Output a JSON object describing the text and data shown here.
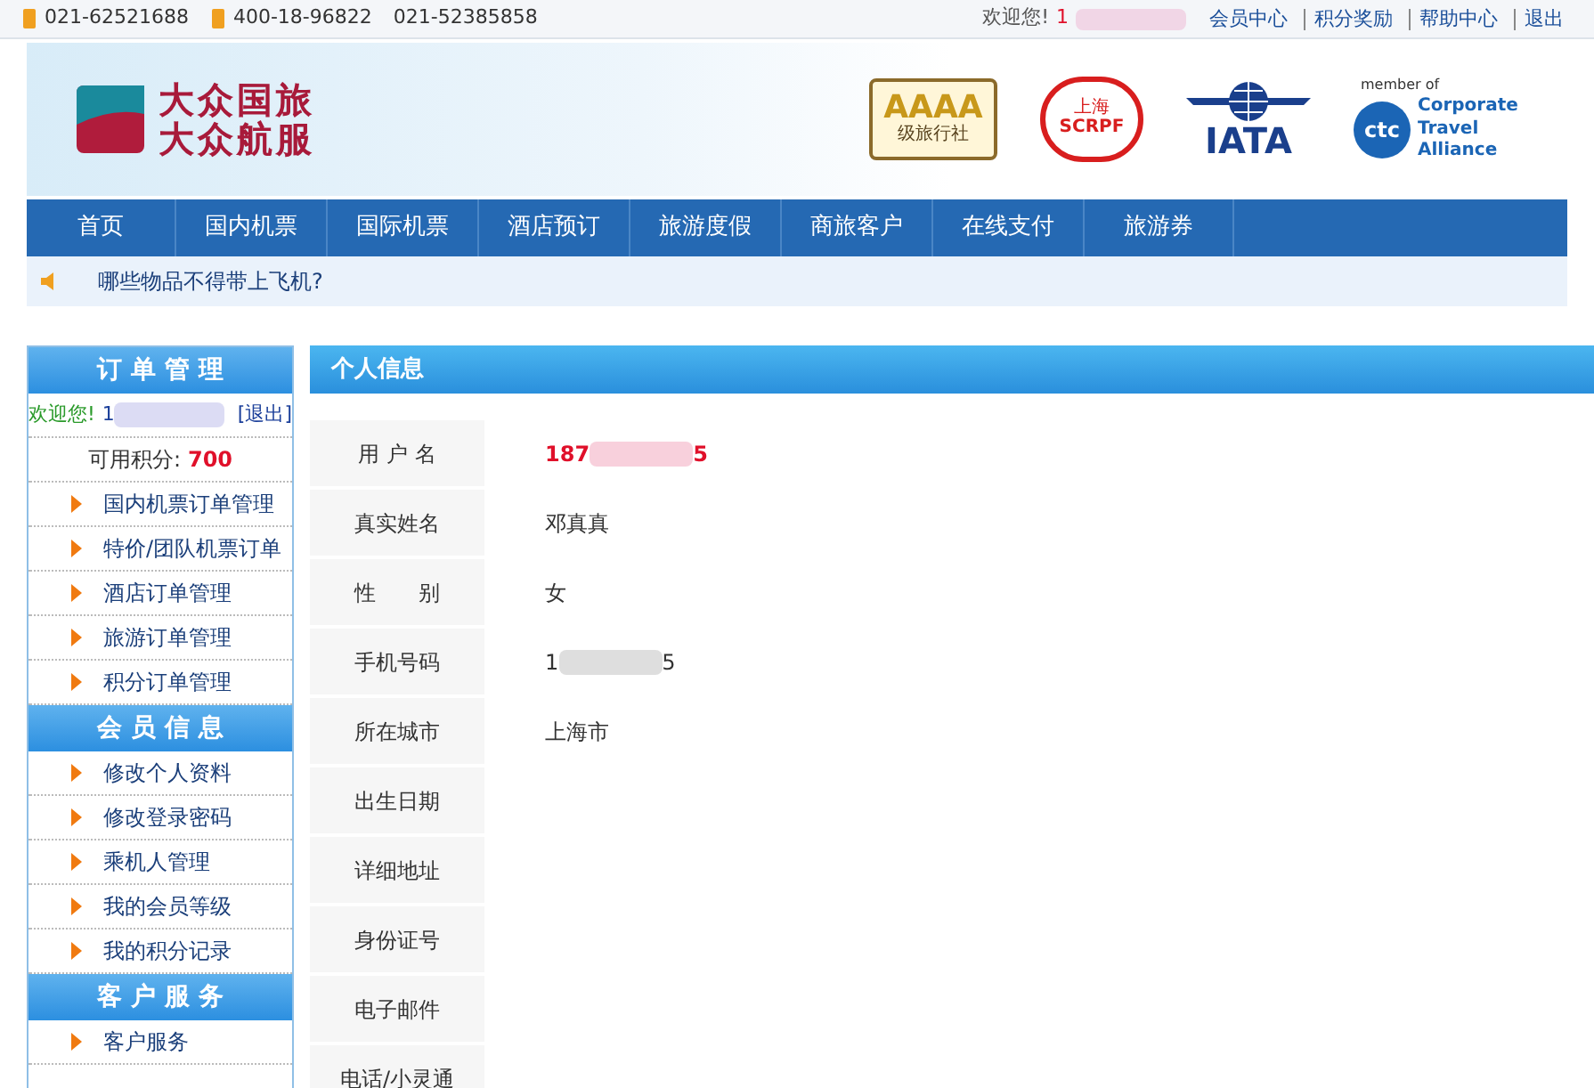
{
  "top_bar": {
    "phones": [
      "021-62521688",
      "400-18-96822",
      "021-52385858"
    ],
    "welcome": "欢迎您!",
    "user_start": "1",
    "links": [
      "会员中心",
      "积分奖励",
      "帮助中心",
      "退出"
    ]
  },
  "banner": {
    "logo_lines": [
      "大众国旅",
      "大众航服"
    ],
    "badges": [
      {
        "kind": "aaaa",
        "text": "AAAA",
        "sub": "级旅行社"
      },
      {
        "kind": "scrpf",
        "text": "SCRPF",
        "sub": "上海"
      },
      {
        "kind": "iata",
        "text": "IATA"
      },
      {
        "kind": "cta",
        "text": "ctc",
        "top": "member of",
        "sub": "Corporate Travel Alliance"
      }
    ]
  },
  "nav": [
    {
      "label": "首页",
      "selected": false
    },
    {
      "label": "国内机票",
      "selected": false
    },
    {
      "label": "国际机票",
      "selected": false
    },
    {
      "label": "酒店预订",
      "selected": false
    },
    {
      "label": "旅游度假",
      "selected": false
    },
    {
      "label": "商旅客户",
      "selected": false
    },
    {
      "label": "在线支付",
      "selected": false
    },
    {
      "label": "旅游券",
      "selected": false
    }
  ],
  "notice": "哪些物品不得带上飞机?",
  "sidebar": {
    "sections": [
      {
        "title": "订 单 管 理",
        "welcome": {
          "label": "欢迎您!",
          "user_start": "1",
          "logout": "[退出]"
        },
        "points": {
          "label": "可用积分:",
          "value": "700"
        },
        "items": [
          "国内机票订单管理",
          "特价/团队机票订单",
          "酒店订单管理",
          "旅游订单管理",
          "积分订单管理"
        ]
      },
      {
        "title": "会 员 信 息",
        "items": [
          "修改个人资料",
          "修改登录密码",
          "乘机人管理",
          "我的会员等级",
          "我的积分记录"
        ]
      },
      {
        "title": "客 户 服 务",
        "items": [
          "客户服务"
        ]
      }
    ]
  },
  "profile": {
    "title": "个人信息",
    "fields": [
      {
        "label": "用 户 名",
        "value": "187",
        "value_end": "5",
        "redacted": true,
        "highlight": true
      },
      {
        "label": "真实姓名",
        "value": "邓真真",
        "redacted": false,
        "highlight": false
      },
      {
        "label": "性　　别",
        "value": "女",
        "redacted": false,
        "highlight": false
      },
      {
        "label": "手机号码",
        "value": "1",
        "value_end": "5",
        "redacted": true,
        "highlight": false
      },
      {
        "label": "所在城市",
        "value": "上海市",
        "redacted": false,
        "highlight": false
      },
      {
        "label": "出生日期"
      },
      {
        "label": "详细地址"
      },
      {
        "label": "身份证号"
      },
      {
        "label": "电子邮件"
      },
      {
        "label": "电话/小灵通"
      }
    ]
  }
}
